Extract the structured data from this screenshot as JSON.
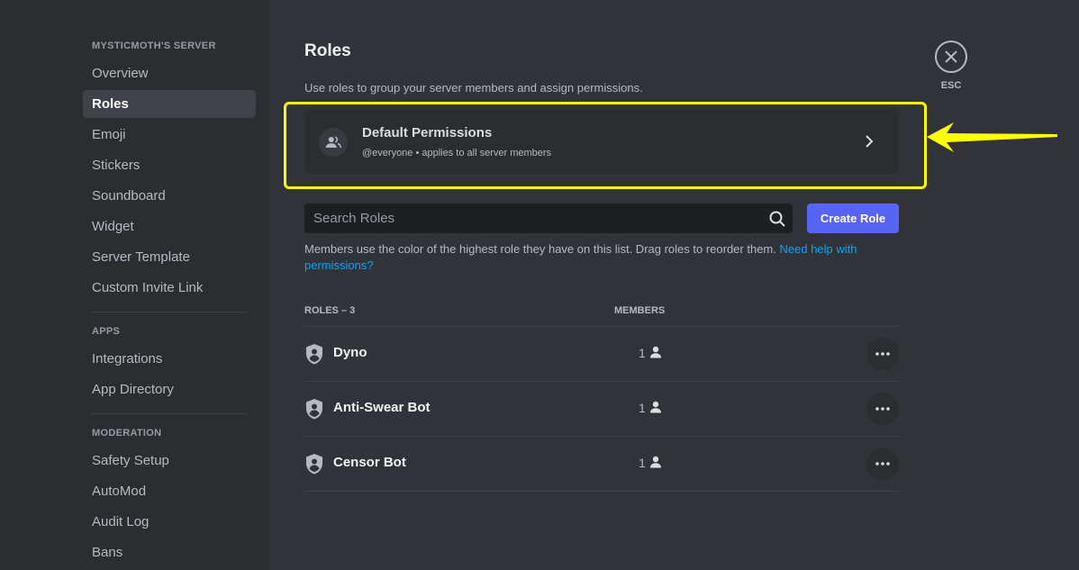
{
  "sidebar": {
    "server_header": "MYSTICMOTH'S SERVER",
    "server_items": [
      {
        "label": "Overview"
      },
      {
        "label": "Roles"
      },
      {
        "label": "Emoji"
      },
      {
        "label": "Stickers"
      },
      {
        "label": "Soundboard"
      },
      {
        "label": "Widget"
      },
      {
        "label": "Server Template"
      },
      {
        "label": "Custom Invite Link"
      }
    ],
    "active_item": "Roles",
    "apps_header": "APPS",
    "apps_items": [
      {
        "label": "Integrations"
      },
      {
        "label": "App Directory"
      }
    ],
    "moderation_header": "MODERATION",
    "moderation_items": [
      {
        "label": "Safety Setup"
      },
      {
        "label": "AutoMod"
      },
      {
        "label": "Audit Log"
      },
      {
        "label": "Bans"
      }
    ]
  },
  "main": {
    "title": "Roles",
    "description": "Use roles to group your server members and assign permissions.",
    "default_permissions": {
      "title": "Default Permissions",
      "subtitle": "@everyone • applies to all server members"
    },
    "search": {
      "placeholder": "Search Roles",
      "value": ""
    },
    "create_role_label": "Create Role",
    "help_text": "Members use the color of the highest role they have on this list. Drag roles to reorder them.",
    "help_link": "Need help with permissions?",
    "table": {
      "roles_header": "ROLES – 3",
      "members_header": "MEMBERS",
      "rows": [
        {
          "name": "Dyno",
          "members": "1"
        },
        {
          "name": "Anti-Swear Bot",
          "members": "1"
        },
        {
          "name": "Censor Bot",
          "members": "1"
        }
      ]
    }
  },
  "close": {
    "label": "ESC"
  },
  "annotation": {
    "highlight_color": "#ffff00"
  },
  "colors": {
    "accent": "#5865f2",
    "link": "#00a8fc",
    "background": "#313338",
    "sidebar": "#2b2d31"
  }
}
